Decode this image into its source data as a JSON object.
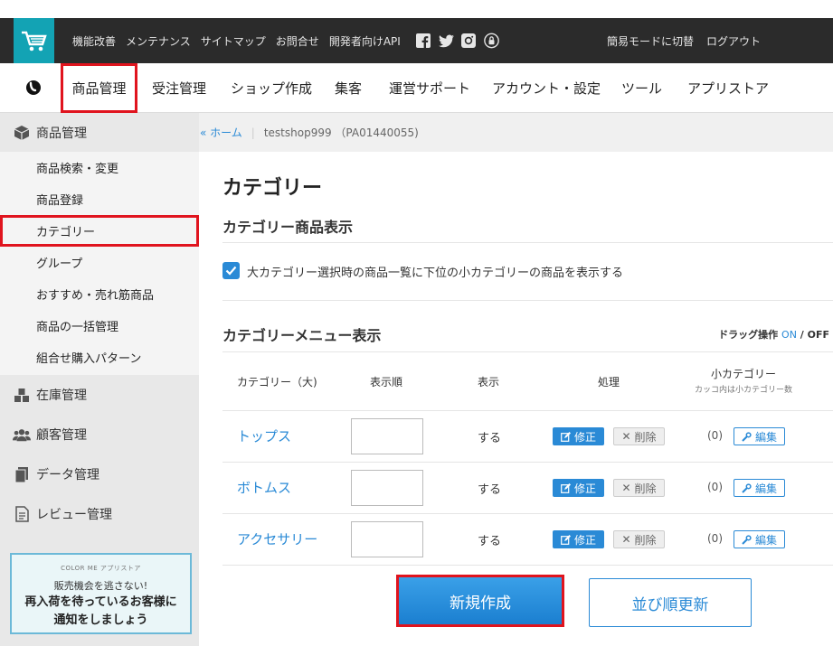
{
  "topbar": {
    "links": [
      "機能改善",
      "メンテナンス",
      "サイトマップ",
      "お問合せ",
      "開発者向けAPI"
    ],
    "right_links": [
      "簡易モードに切替",
      "ログアウト"
    ]
  },
  "mainnav": {
    "items": [
      "商品管理",
      "受注管理",
      "ショップ作成",
      "集客",
      "運営サポート",
      "アカウント・設定",
      "ツール",
      "アプリストア"
    ]
  },
  "sidebar": {
    "product_section": "商品管理",
    "product_items": [
      "商品検索・変更",
      "商品登録",
      "カテゴリー",
      "グループ",
      "おすすめ・売れ筋商品",
      "商品の一括管理",
      "組合せ購入パターン"
    ],
    "other_sections": [
      "在庫管理",
      "顧客管理",
      "データ管理",
      "レビュー管理"
    ],
    "banner": {
      "brand": "COLOR ME アプリストア",
      "line1": "販売機会を逃さない!",
      "line2": "再入荷を待っているお客様に",
      "line3": "通知をしましょう"
    }
  },
  "breadcrumb": {
    "home": "« ホーム",
    "shop": "testshop999 （PA01440055)"
  },
  "page": {
    "title": "カテゴリー",
    "section1_title": "カテゴリー商品表示",
    "checkbox_label": "大カテゴリー選択時の商品一覧に下位の小カテゴリーの商品を表示する",
    "section2_title": "カテゴリーメニュー表示",
    "drag_label": "ドラッグ操作",
    "drag_on": "ON",
    "drag_sep": " / ",
    "drag_off": "OFF"
  },
  "table": {
    "headers": {
      "category": "カテゴリー（大)",
      "order": "表示順",
      "display": "表示",
      "action": "処理",
      "sub": "小カテゴリー",
      "sub_note": "カッコ内は小カテゴリー数"
    },
    "rows": [
      {
        "name": "トップス",
        "order": "",
        "display": "する",
        "edit": "修正",
        "delete": "削除",
        "sub_count": "(0)",
        "sub_edit": "編集"
      },
      {
        "name": "ボトムス",
        "order": "",
        "display": "する",
        "edit": "修正",
        "delete": "削除",
        "sub_count": "(0)",
        "sub_edit": "編集"
      },
      {
        "name": "アクセサリー",
        "order": "",
        "display": "する",
        "edit": "修正",
        "delete": "削除",
        "sub_count": "(0)",
        "sub_edit": "編集"
      }
    ]
  },
  "buttons": {
    "create": "新規作成",
    "reorder": "並び順更新"
  },
  "colors": {
    "accent": "#2a8ad6",
    "logo_bg": "#13a3b4",
    "topbar_bg": "#2b2b2b",
    "highlight": "#e0141e"
  },
  "icons": {
    "logo": "cart-icon",
    "social": [
      "facebook-icon",
      "twitter-icon",
      "instagram-icon",
      "lock-icon"
    ]
  }
}
